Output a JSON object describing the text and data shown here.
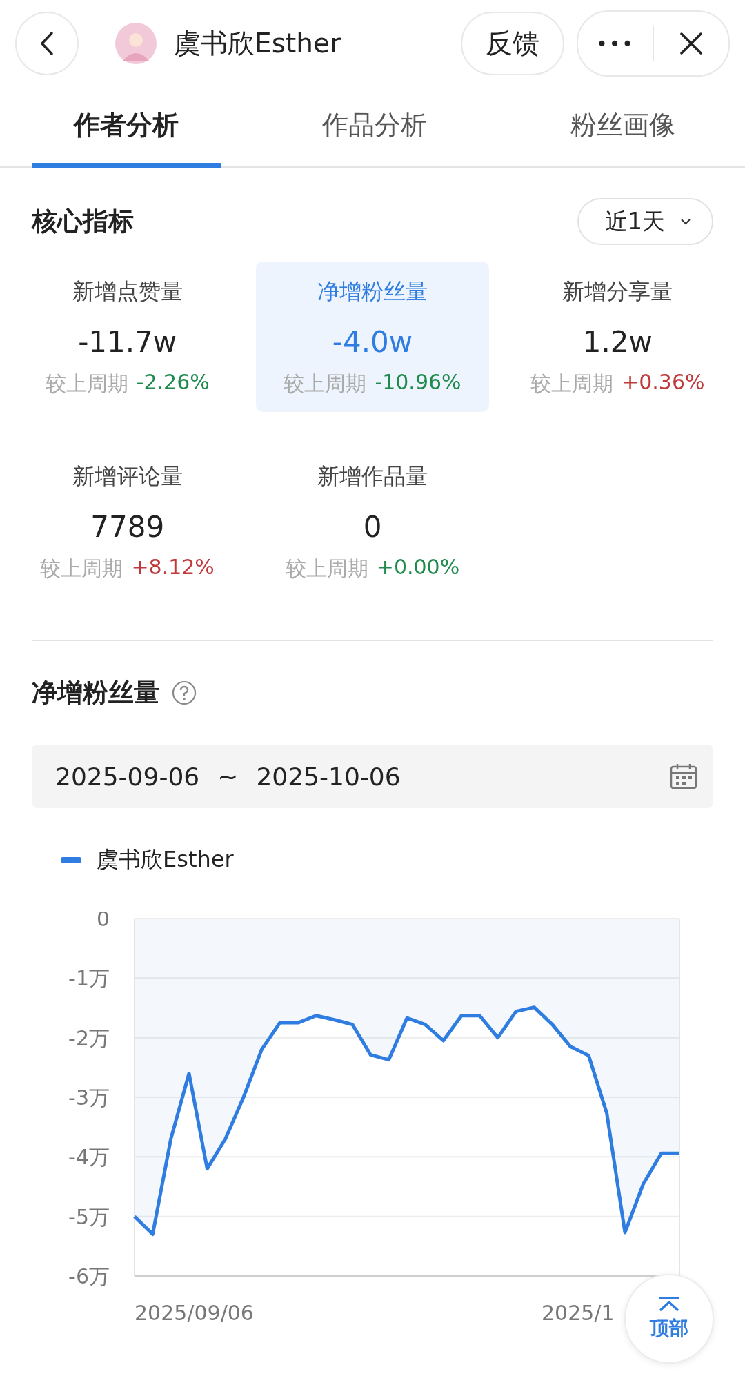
{
  "header": {
    "title": "虞书欣Esther",
    "feedback": "反馈",
    "more": "•••"
  },
  "tabs": [
    {
      "label": "作者分析",
      "selected": true
    },
    {
      "label": "作品分析",
      "selected": false
    },
    {
      "label": "粉丝画像",
      "selected": false
    }
  ],
  "core": {
    "title": "核心指标",
    "period": "近1天",
    "metrics": [
      {
        "label": "新增点赞量",
        "value": "-11.7w",
        "compare": "较上周期",
        "change": "-2.26%",
        "color": "#1e8a4c",
        "selected": false
      },
      {
        "label": "净增粉丝量",
        "value": "-4.0w",
        "compare": "较上周期",
        "change": "-10.96%",
        "color": "#1e8a4c",
        "selected": true
      },
      {
        "label": "新增分享量",
        "value": "1.2w",
        "compare": "较上周期",
        "change": "+0.36%",
        "color": "#c0393b",
        "selected": false
      },
      {
        "label": "新增评论量",
        "value": "7789",
        "compare": "较上周期",
        "change": "+8.12%",
        "color": "#c0393b",
        "selected": false
      },
      {
        "label": "新增作品量",
        "value": "0",
        "compare": "较上周期",
        "change": "+0.00%",
        "color": "#1e8a4c",
        "selected": false
      }
    ]
  },
  "trend": {
    "title": "净增粉丝量",
    "date_from": "2025-09-06",
    "date_sep": "~",
    "date_to": "2025-10-06",
    "x_axis_labels": [
      "2025/09/06",
      "2025/1"
    ],
    "chart_data": {
      "type": "area",
      "grid": true,
      "categories": [
        null,
        null,
        null,
        null,
        null,
        null,
        null,
        null,
        null,
        null,
        null,
        null,
        null,
        null,
        null,
        null,
        null,
        null,
        null,
        null,
        null,
        null,
        null,
        null,
        null,
        null,
        null,
        null,
        null,
        null,
        null
      ],
      "series": [
        {
          "name": "虞书欣Esther",
          "color": "#2f7de1",
          "values": [
            -5.0,
            -5.3,
            -3.7,
            -2.6,
            -4.2,
            -3.7,
            -3.0,
            -2.2,
            -1.75,
            -1.75,
            -1.63,
            -1.7,
            -1.78,
            -2.29,
            -2.37,
            -1.67,
            -1.78,
            -2.05,
            -1.63,
            -1.63,
            -2.0,
            -1.56,
            -1.49,
            -1.78,
            -2.15,
            -2.3,
            -3.27,
            -5.27,
            -4.46,
            -3.94,
            -3.94
          ]
        }
      ],
      "ylim": [
        -6,
        0
      ],
      "yticks": [
        {
          "value": 0,
          "label": "0"
        },
        {
          "value": -1,
          "label": "-1万"
        },
        {
          "value": -2,
          "label": "-2万"
        },
        {
          "value": -3,
          "label": "-3万"
        },
        {
          "value": -4,
          "label": "-4万"
        },
        {
          "value": -5,
          "label": "-5万"
        },
        {
          "value": -6,
          "label": "-6万"
        }
      ]
    }
  },
  "top_button": {
    "label": "顶部"
  }
}
